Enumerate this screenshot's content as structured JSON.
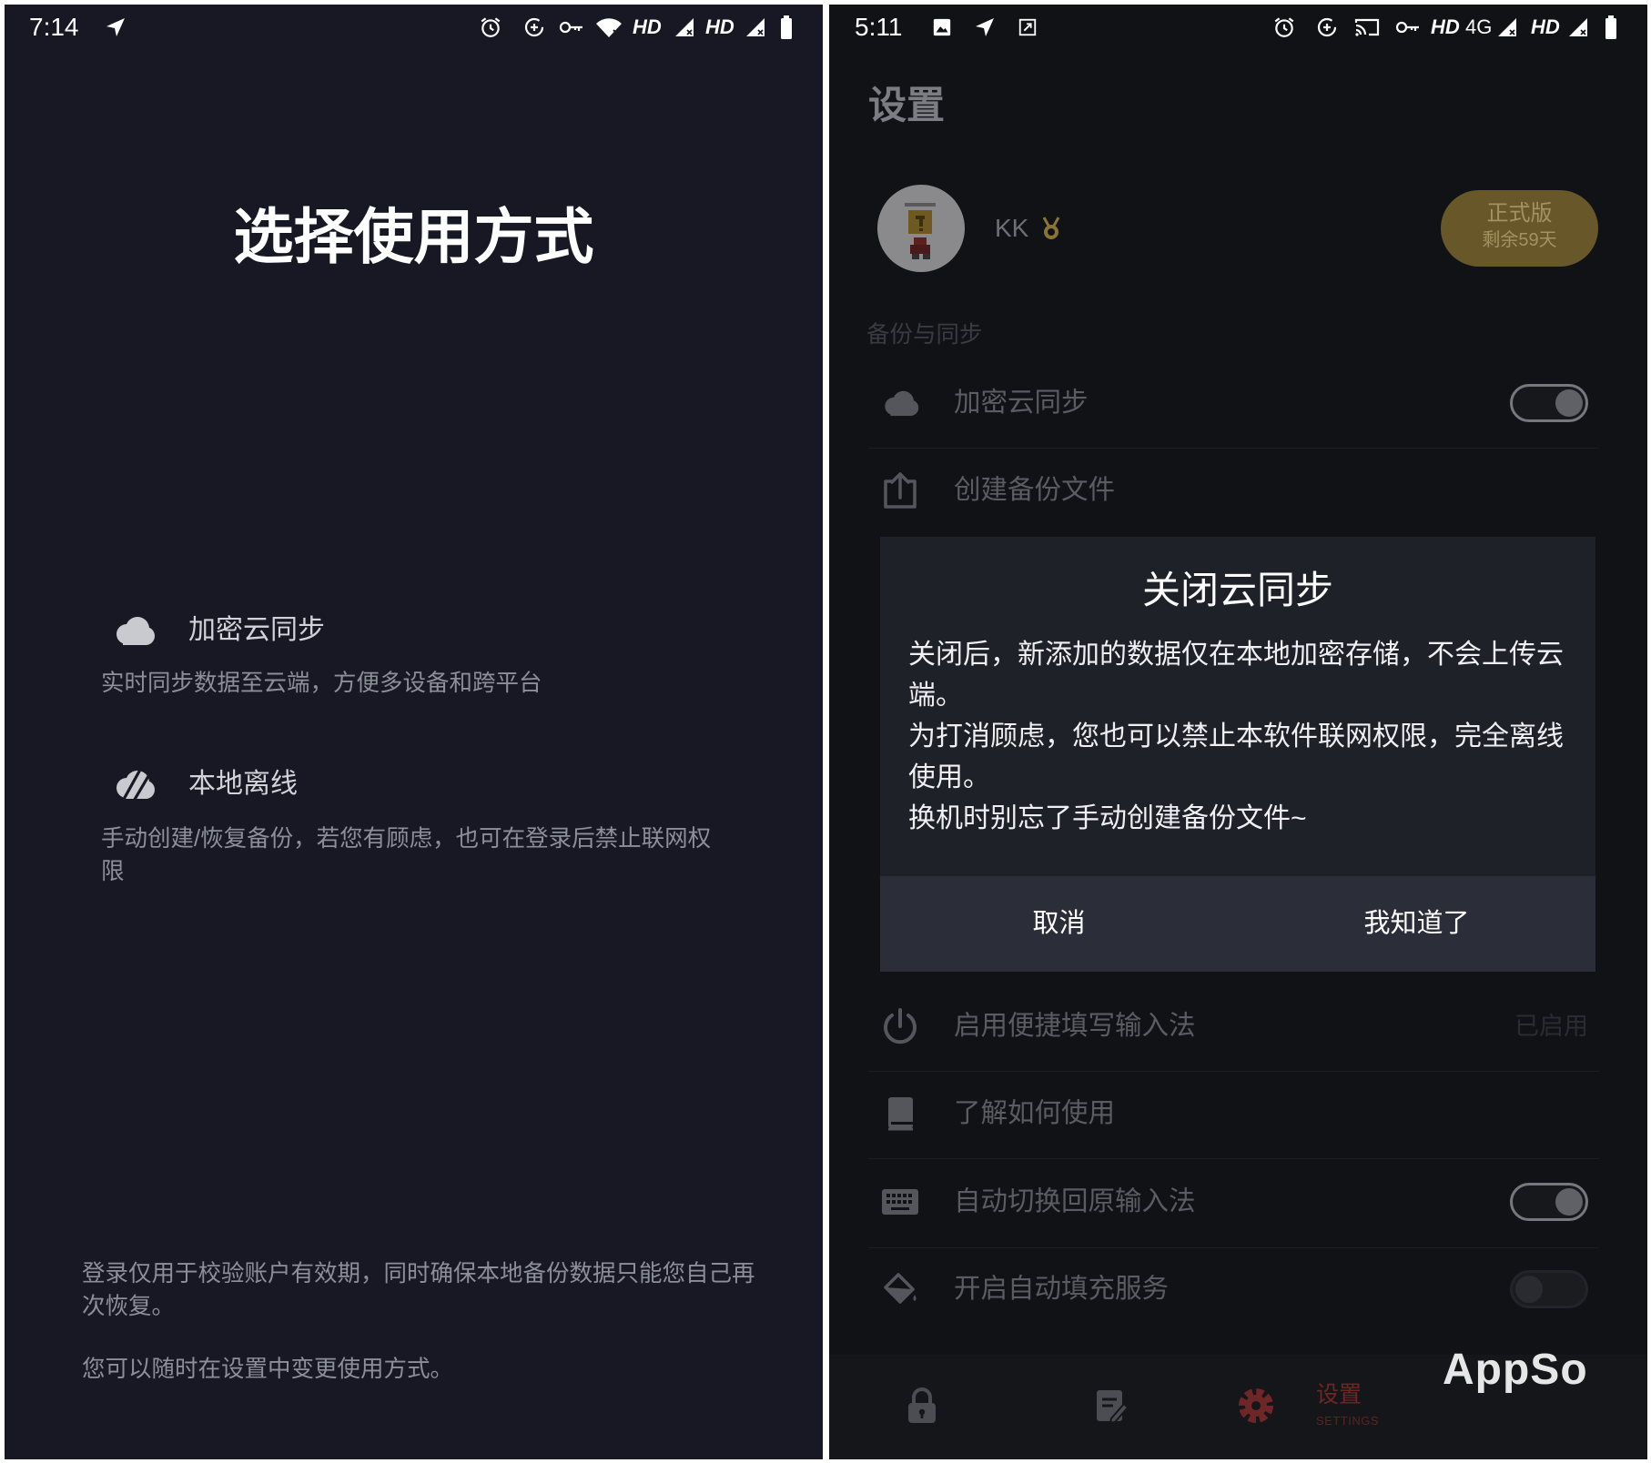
{
  "left_screen": {
    "status_bar": {
      "time": "7:14",
      "hd_1": "HD",
      "hd_2": "HD"
    },
    "title": "选择使用方式",
    "options": [
      {
        "icon": "cloud-icon",
        "label": "加密云同步",
        "description": "实时同步数据至云端，方便多设备和跨平台"
      },
      {
        "icon": "cloud-off-icon",
        "label": "本地离线",
        "description": "手动创建/恢复备份，若您有顾虑，也可在登录后禁止联网权限"
      }
    ],
    "footer_note": "登录仅用于校验账户有效期，同时确保本地备份数据只能您自己再次恢复。",
    "footer_hint": "您可以随时在设置中变更使用方式。"
  },
  "right_screen": {
    "status_bar": {
      "time": "5:11",
      "hd_1": "HD",
      "network": "4G",
      "hd_2": "HD"
    },
    "page_title": "设置",
    "profile": {
      "name": "KK",
      "badge_title": "正式版",
      "badge_subtitle": "剩余59天"
    },
    "section_backup": "备份与同步",
    "settings_rows": [
      {
        "icon": "cloud-icon",
        "label": "加密云同步",
        "toggle_on": true
      },
      {
        "icon": "upload-icon",
        "label": "创建备份文件"
      },
      {
        "icon": "power-icon",
        "label": "启用便捷填写输入法",
        "value": "已启用"
      },
      {
        "icon": "book-icon",
        "label": "了解如何使用"
      },
      {
        "icon": "keyboard-icon",
        "label": "自动切换回原输入法",
        "toggle_on": true
      },
      {
        "icon": "paint-bucket-icon",
        "label": "开启自动填充服务",
        "toggle_on": false
      }
    ],
    "dialog": {
      "title": "关闭云同步",
      "paragraphs": [
        "关闭后，新添加的数据仅在本地加密存储，不会上传云端。",
        "为打消顾虑，您也可以禁止本软件联网权限，完全离线使用。",
        "换机时别忘了手动创建备份文件~"
      ],
      "cancel": "取消",
      "confirm": "我知道了"
    },
    "bottom_nav": [
      {
        "icon": "lock-icon"
      },
      {
        "icon": "edit-icon"
      },
      {
        "icon": "gear-icon",
        "label": "设置",
        "sublabel": "SETTINGS",
        "active": true
      }
    ],
    "watermark": "AppSo"
  },
  "colors": {
    "left_background": "#171823",
    "right_background": "#111215",
    "dialog_background": "#1f2129",
    "dialog_button_bar": "#2b2e38",
    "badge_background": "#675729",
    "active_tab": "#6e2626"
  }
}
